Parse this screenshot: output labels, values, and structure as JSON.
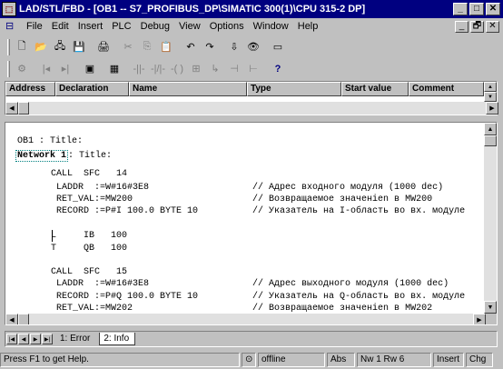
{
  "window": {
    "title": "LAD/STL/FBD  - [OB1 -- S7_PROFIBUS_DP\\SIMATIC 300(1)\\CPU 315-2 DP]",
    "app_icon": "LAD/STL/FBD application icon",
    "min_glyph": "_",
    "max_glyph": "□",
    "close_glyph": "✕"
  },
  "menu": {
    "items": [
      "File",
      "Edit",
      "Insert",
      "PLC",
      "Debug",
      "View",
      "Options",
      "Window",
      "Help"
    ],
    "mdi_icon": "document-icon",
    "mdi_min": "_",
    "mdi_restore": "🗗",
    "mdi_close": "✕"
  },
  "toolbar1": {
    "buttons": [
      "new-icon",
      "open-icon",
      "network-icon",
      "save-icon",
      "print-icon",
      "cut-icon",
      "copy-icon",
      "paste-icon",
      "undo-icon",
      "redo-icon",
      "download-icon",
      "monitor-icon",
      "window-icon"
    ],
    "glyphs": [
      "🗋",
      "📂",
      "🖧",
      "💾",
      "🖨",
      "✂",
      "⎘",
      "📋",
      "↶",
      "↷",
      "⇩",
      "👁",
      "▭"
    ]
  },
  "toolbar2": {
    "buttons": [
      "online-icon",
      "prev-icon",
      "next-icon",
      "overview-icon",
      "grid-icon",
      "contact-no-icon",
      "contact-nc-icon",
      "coil-icon",
      "box-icon",
      "branch-open-icon",
      "branch-close-icon",
      "connect-icon",
      "help-icon"
    ],
    "glyphs": [
      "⚙",
      "|◂",
      "▸|",
      "▣",
      "▦",
      "-||-",
      "-|/|-",
      "-( )",
      "⊞",
      "↳",
      "⊣",
      "⊢",
      "?"
    ]
  },
  "declaration": {
    "columns": [
      "Address",
      "Declaration",
      "Name",
      "Type",
      "Start value",
      "Comment"
    ]
  },
  "code": {
    "block_title": "OB1 : Title:",
    "network_label": "Network 1",
    "network_title": ": Title:",
    "lines": [
      "CALL  SFC   14",
      " LADDR  :=W#16#3E8                   // Адрес входного модуля (1000 dec)",
      " RET_VAL:=MW200                      // Возвращаемое значенien в MW200",
      " RECORD :=P#I 100.0 BYTE 10          // Указатель на I-область во вх. модуле",
      "",
      "L     IB   100",
      "T     QB   100",
      "",
      "CALL  SFC   15",
      " LADDR  :=W#16#3E8                   // Адрес выходного модуля (1000 dec)",
      " RECORD :=P#Q 100.0 BYTE 10          // Указатель на Q-область во вх. модуле",
      " RET_VAL:=MW202                      // Возвращаемое значенien в MW202"
    ]
  },
  "output_tabs": {
    "tabs": [
      "1: Error",
      "2: Info"
    ],
    "active": "2: Info"
  },
  "status": {
    "help": "Press F1 to get Help.",
    "state": "offline",
    "mode": "Abs",
    "position": "Nw 1  Rw 6",
    "insert": "Insert",
    "chg": "Chg"
  }
}
